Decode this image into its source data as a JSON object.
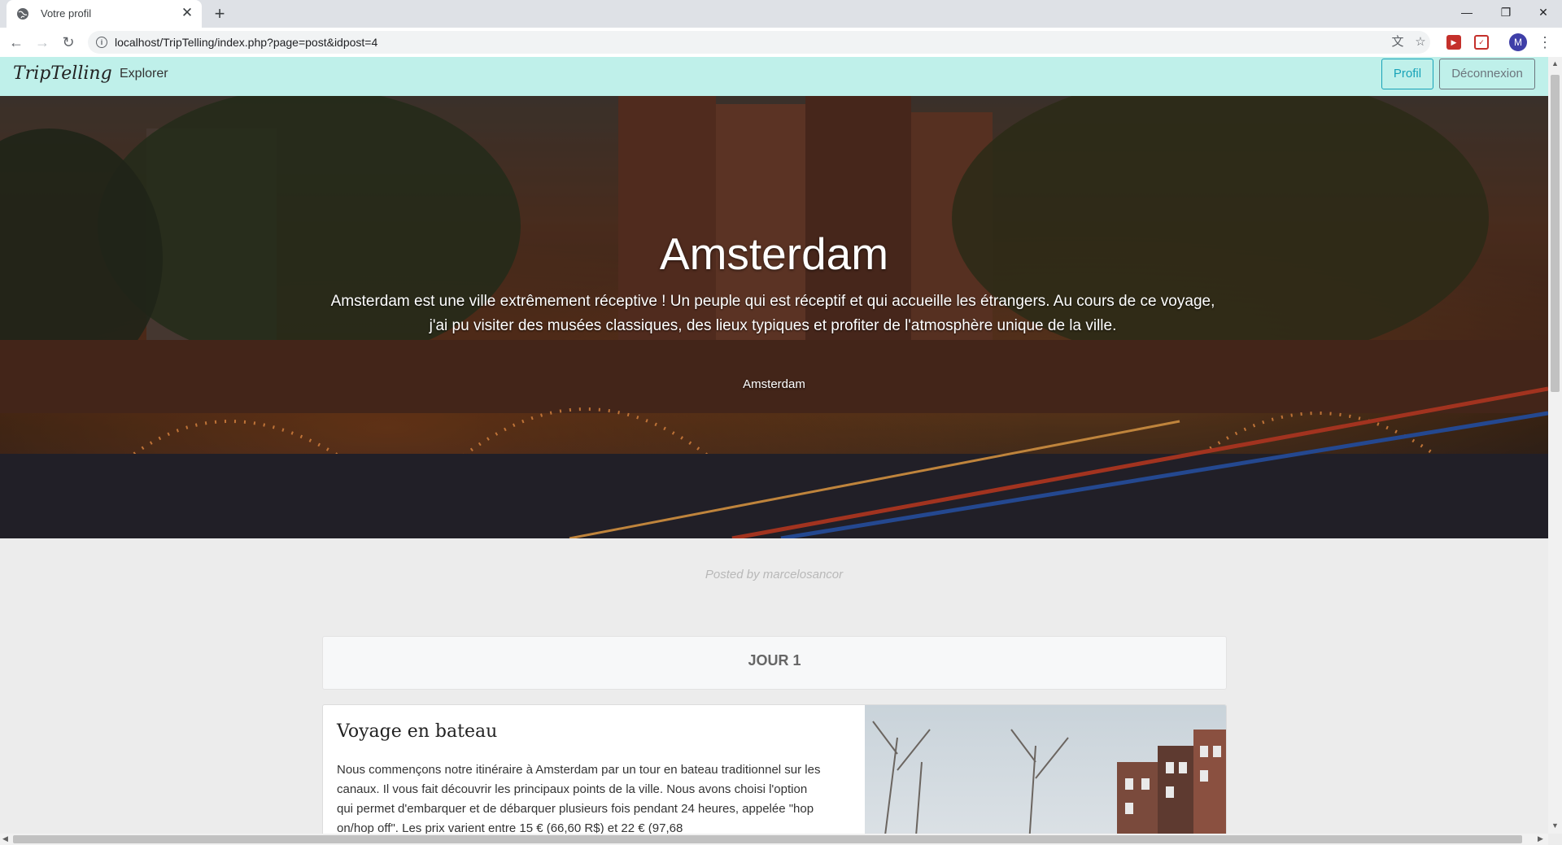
{
  "browser": {
    "tab_title": "Votre profil",
    "close_tab_glyph": "✕",
    "new_tab_glyph": "+",
    "url": "localhost/TripTelling/index.php?page=post&idpost=4",
    "window_controls": {
      "minimize": "—",
      "restore": "❐",
      "close": "✕"
    },
    "nav": {
      "back": "←",
      "forward": "→",
      "reload": "↻"
    },
    "profile_initial": "M",
    "menu_glyph": "⋮"
  },
  "site": {
    "brand": "TripTelling",
    "nav_link": "Explorer",
    "profil_button": "Profil",
    "logout_button": "Déconnexion"
  },
  "hero": {
    "title": "Amsterdam",
    "description": "Amsterdam est une ville extrêmement réceptive ! Un peuple qui est réceptif et qui accueille les étrangers. Au cours de ce voyage, j'ai pu visiter des musées classiques, des lieux typiques et profiter de l'atmosphère unique de la ville.",
    "tag": "Amsterdam"
  },
  "post": {
    "posted_by": "Posted by marcelosancor",
    "day_label": "JOUR 1",
    "step": {
      "title": "Voyage en bateau",
      "text": "Nous commençons notre itinéraire à Amsterdam par un tour en bateau traditionnel sur les canaux. Il vous fait découvrir les principaux points de la ville. Nous avons choisi l'option qui permet d'embarquer et de débarquer plusieurs fois pendant 24 heures, appelée \"hop on/hop off\". Les prix varient entre 15 € (66,60 R$) et 22 € (97,68"
    }
  },
  "colors": {
    "navbar_bg": "#bff0ea",
    "accent": "#17a2b8",
    "secondary": "#6c757d"
  }
}
